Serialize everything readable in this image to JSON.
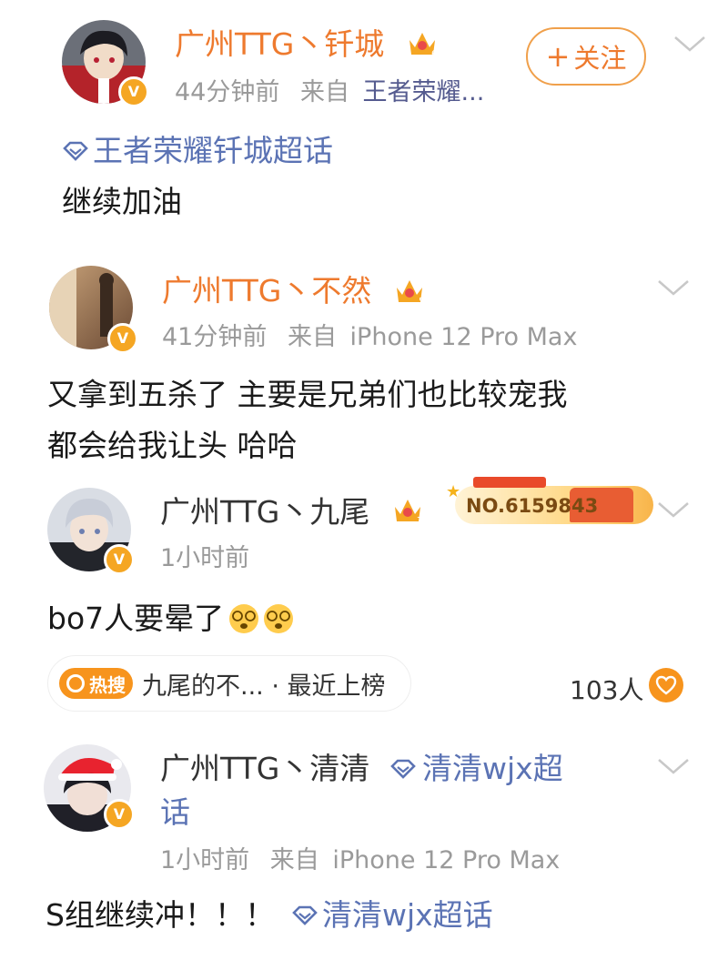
{
  "posts": [
    {
      "name": "广州TTG丶钎城",
      "crown_level": "6",
      "time": "44分钟前",
      "from_label": "来自",
      "source": "王者荣耀...",
      "follow_plus": "+",
      "follow_label": "关注",
      "topic": "王者荣耀钎城超话",
      "text": "继续加油",
      "name_color": "#ee7a2e"
    },
    {
      "name": "广州TTG丶不然",
      "crown_level": "5",
      "time": "41分钟前",
      "from_label": "来自",
      "source": "iPhone 12 Pro Max",
      "text_lines": [
        "又拿到五杀了 主要是兄弟们也比较宠我",
        "都会给我让头 哈哈"
      ],
      "name_color": "#ee7a2e"
    },
    {
      "name": "广州TTG丶九尾",
      "crown_level": "7",
      "medal": "NO.6159843",
      "time": "1小时前",
      "text": "bo7人要晕了",
      "emoji": [
        "dizzy-face",
        "dizzy-face"
      ],
      "hot_tag": "热搜",
      "hot_text": "九尾的不... · 最近上榜",
      "likes": "103人",
      "name_color": "#333333"
    },
    {
      "name": "广州TTG丶清清",
      "topic": "清清wjx超",
      "topic_cont": "话",
      "time": "1小时前",
      "from_label": "来自",
      "source": "iPhone 12 Pro Max",
      "text": "S组继续冲！！！",
      "text_topic": "清清wjx超话",
      "name_color": "#333333"
    }
  ],
  "colors": {
    "accent": "#ee7a2e",
    "verified": "#f5a623",
    "topic": "#5b73b4",
    "meta": "#9a9a9a"
  },
  "icons": [
    "verified-badge-icon",
    "crown-level-icon",
    "chevron-down-icon",
    "super-topic-icon",
    "hot-search-icon",
    "like-icon",
    "dizzy-face-emoji"
  ]
}
